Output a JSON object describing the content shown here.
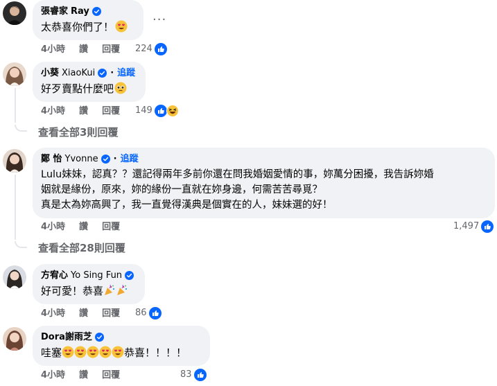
{
  "comments": [
    {
      "name_zh": "張睿家",
      "name_en": "Ray",
      "follow": "",
      "lines": [
        "太恭喜你們了！"
      ],
      "time": "4小時",
      "like": "讚",
      "reply": "回覆",
      "reactions": "224"
    },
    {
      "name_zh": "小葵",
      "name_en": "XiaoKui",
      "follow": "追蹤",
      "lines": [
        "好歹賣點什麼吧"
      ],
      "time": "4小時",
      "like": "讚",
      "reply": "回覆",
      "reactions": "149"
    },
    {
      "name_zh": "鄭 怡",
      "name_en": "Yvonne",
      "follow": "追蹤",
      "lines": [
        "Lulu妹妹，認真？？還記得兩年多前你還在問我婚姻愛情的事，妳萬分困擾，我告訴妳婚",
        "姻就是緣份，原來，妳的緣份一直就在妳身邊，何需苦苦尋覓？",
        "真是太為妳高興了，我一直覺得漢典是個實在的人，妹妹選的好！"
      ],
      "time": "4小時",
      "like": "讚",
      "reply": "回覆",
      "reactions": "1,497"
    },
    {
      "name_zh": "方宥心",
      "name_en": "Yo Sing Fun",
      "follow": "",
      "lines": [
        "好可愛！恭喜"
      ],
      "time": "4小時",
      "like": "讚",
      "reply": "回覆",
      "reactions": "86"
    },
    {
      "name_zh": "Dora謝雨芝",
      "name_en": "",
      "follow": "",
      "lines": [
        "哇塞",
        "恭喜！！！！"
      ],
      "time": "4小時",
      "like": "讚",
      "reply": "回覆",
      "reactions": "83"
    }
  ],
  "view_replies": [
    "查看全部3則回覆",
    "查看全部28則回覆"
  ],
  "more_glyph": "···",
  "colors": {
    "bubble": "#f0f2f5",
    "secondary_text": "#65676b",
    "link_blue": "#0866ff",
    "verified_blue": "#0866ff"
  }
}
